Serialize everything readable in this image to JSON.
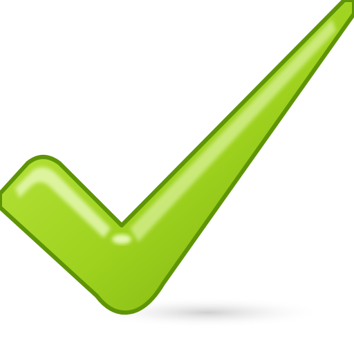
{
  "icon": {
    "name": "checkmark-icon",
    "colors": {
      "fill_light": "#c4ec4a",
      "fill_mid": "#9ed21e",
      "fill_dark": "#72a80c",
      "outline": "#5e9406",
      "highlight": "#eefcc4",
      "shadow": "#cfcfcf",
      "background": "#ffffff"
    }
  }
}
